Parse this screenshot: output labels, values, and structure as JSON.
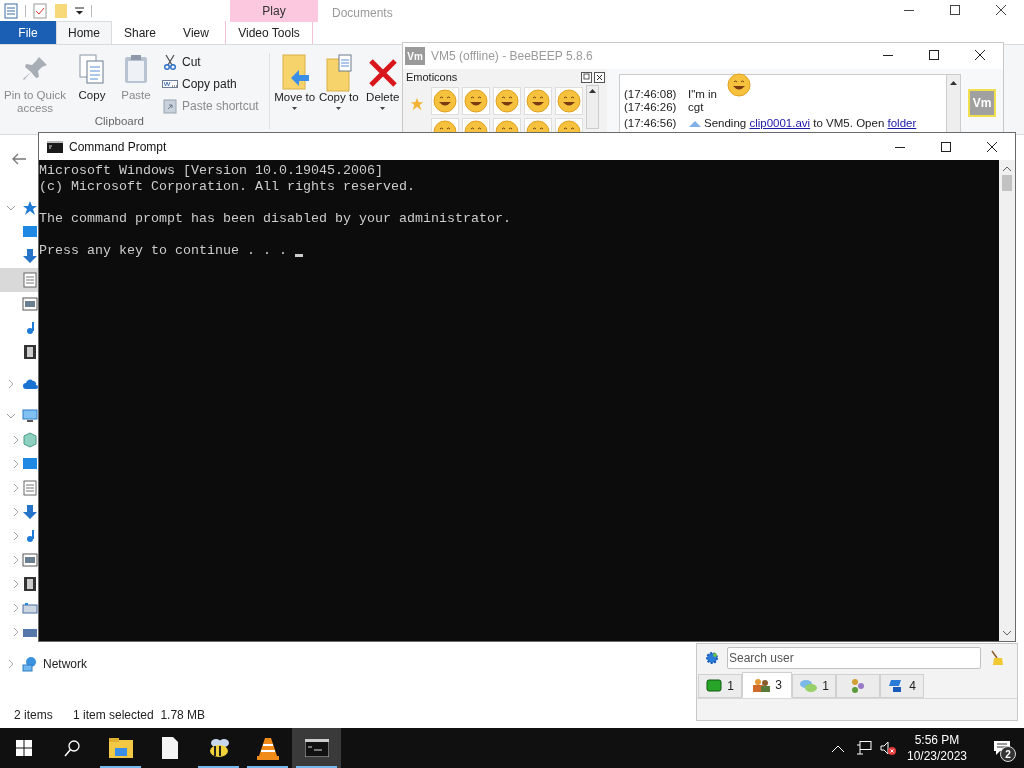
{
  "explorer": {
    "context_tab_group": "Play",
    "title": "Documents",
    "ribbon_tabs": [
      {
        "label": "File",
        "kind": "file",
        "selected": false
      },
      {
        "label": "Home",
        "kind": "tab",
        "selected": true
      },
      {
        "label": "Share",
        "kind": "tab",
        "selected": false
      },
      {
        "label": "View",
        "kind": "tab",
        "selected": false
      },
      {
        "label": "Video Tools",
        "kind": "context",
        "selected": false
      }
    ],
    "clipboard": {
      "group_label": "Clipboard",
      "large": [
        {
          "label": "Pin to Quick access",
          "kind": "pin",
          "disabled": true
        },
        {
          "label": "Copy",
          "kind": "copy",
          "disabled": false
        },
        {
          "label": "Paste",
          "kind": "paste",
          "disabled": true
        }
      ],
      "small": [
        {
          "label": "Cut",
          "kind": "cut",
          "disabled": false
        },
        {
          "label": "Copy path",
          "kind": "path",
          "disabled": false
        },
        {
          "label": "Paste shortcut",
          "kind": "shortcut",
          "disabled": true
        }
      ]
    },
    "organize": [
      {
        "label": "Move to",
        "kind": "move"
      },
      {
        "label": "Copy to",
        "kind": "copyto"
      },
      {
        "label": "Delete",
        "kind": "delete"
      }
    ],
    "nav_tree": [
      {
        "kind": "quick-access",
        "expanded": true,
        "selected": false,
        "children": [
          {
            "kind": "desktop",
            "selected": false
          },
          {
            "kind": "downloads",
            "selected": false
          },
          {
            "kind": "documents",
            "selected": true
          },
          {
            "kind": "pictures",
            "selected": false
          },
          {
            "kind": "music",
            "selected": false
          },
          {
            "kind": "videos",
            "selected": false
          }
        ]
      },
      {
        "kind": "onedrive",
        "expanded": false,
        "selected": false
      },
      {
        "kind": "this-pc",
        "expanded": true,
        "selected": false,
        "children": [
          {
            "kind": "objects",
            "expanded": false,
            "selected": false
          },
          {
            "kind": "desktop",
            "expanded": false,
            "selected": false
          },
          {
            "kind": "documents",
            "expanded": false,
            "selected": false
          },
          {
            "kind": "downloads",
            "expanded": false,
            "selected": false
          },
          {
            "kind": "music",
            "expanded": false,
            "selected": false
          },
          {
            "kind": "pictures",
            "expanded": false,
            "selected": false
          },
          {
            "kind": "videos",
            "expanded": false,
            "selected": false
          },
          {
            "kind": "drive",
            "expanded": false,
            "selected": false
          },
          {
            "kind": "drive-dark",
            "expanded": false,
            "selected": false
          }
        ]
      },
      {
        "kind": "network",
        "label": "Network",
        "expanded": false,
        "selected": false
      }
    ],
    "status_bar": {
      "items": "2 items",
      "selection": "1 item selected  1.78 MB"
    }
  },
  "beebeep": {
    "avatar": "Vm",
    "title": "VM5 (offline) - BeeBEEP 5.8.6",
    "emoticons_title": "Emoticons",
    "chat": [
      {
        "kind": "emoji-message",
        "time": "(17:46:08)",
        "text": "I\"m in"
      },
      {
        "kind": "message",
        "time": "(17:46:26)",
        "text": "cgt"
      },
      {
        "kind": "transfer",
        "time": "(17:46:56)",
        "before": "Sending ",
        "link": "clip0001.avi",
        "middle": " to VM5. Open ",
        "link2": "folder"
      }
    ],
    "user_avatar": "Vm",
    "search": {
      "placeholder": "Search user"
    },
    "tabs": [
      {
        "kind": "chat",
        "count": "1",
        "selected": false
      },
      {
        "kind": "users",
        "count": "3",
        "selected": true
      },
      {
        "kind": "bubbles",
        "count": "1",
        "selected": false
      },
      {
        "kind": "groups",
        "selected": false
      },
      {
        "kind": "network",
        "count": "4",
        "selected": false
      }
    ]
  },
  "cmd": {
    "title": "Command Prompt",
    "blocks": [
      [
        "Microsoft Windows [Version 10.0.19045.2006]",
        "(c) Microsoft Corporation. All rights reserved."
      ],
      [
        "The command prompt has been disabled by your administrator."
      ],
      [
        "Press any key to continue . . . "
      ]
    ]
  },
  "taskbar": {
    "apps": [
      {
        "kind": "explorer",
        "running": true,
        "selected": false
      },
      {
        "kind": "notepad",
        "running": false,
        "selected": false
      },
      {
        "kind": "bee",
        "running": true,
        "selected": false
      },
      {
        "kind": "vlc",
        "running": true,
        "selected": false
      },
      {
        "kind": "cmd",
        "running": true,
        "selected": true
      }
    ],
    "time": "5:56 PM",
    "date": "10/23/2023",
    "volume_muted": true,
    "notifications": "2"
  }
}
